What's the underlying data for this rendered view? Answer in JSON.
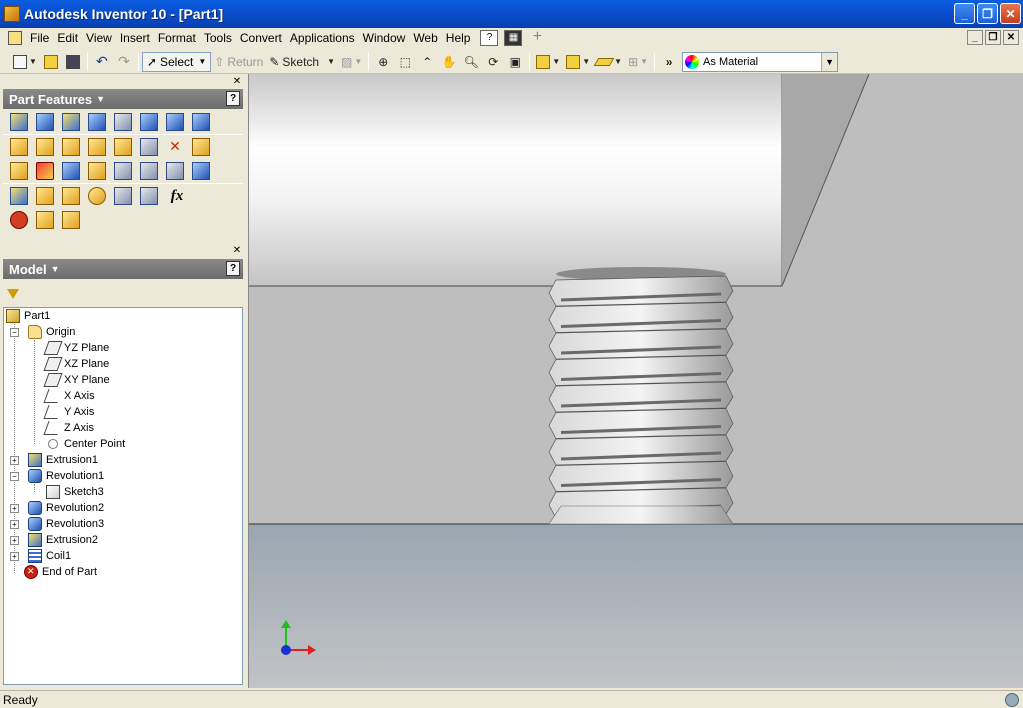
{
  "window": {
    "title": "Autodesk Inventor 10 - [Part1]",
    "icon": "inventor-app-icon",
    "buttons": [
      "minimize",
      "restore",
      "close"
    ]
  },
  "menu": {
    "items": [
      "File",
      "Edit",
      "View",
      "Insert",
      "Format",
      "Tools",
      "Convert",
      "Applications",
      "Window",
      "Web",
      "Help"
    ]
  },
  "toolbar": {
    "select_label": "Select",
    "return_label": "Return",
    "sketch_label": "Sketch",
    "material_value": "As Material"
  },
  "part_features": {
    "title": "Part Features",
    "help": "?"
  },
  "model_panel": {
    "title": "Model",
    "help": "?"
  },
  "tree": {
    "root": "Part1",
    "origin": "Origin",
    "yz_plane": "YZ Plane",
    "xz_plane": "XZ Plane",
    "xy_plane": "XY Plane",
    "x_axis": "X Axis",
    "y_axis": "Y Axis",
    "z_axis": "Z Axis",
    "center_point": "Center Point",
    "extrusion1": "Extrusion1",
    "revolution1": "Revolution1",
    "sketch3": "Sketch3",
    "revolution2": "Revolution2",
    "revolution3": "Revolution3",
    "extrusion2": "Extrusion2",
    "coil1": "Coil1",
    "end_of_part": "End of Part"
  },
  "status": {
    "text": "Ready"
  },
  "colors": {
    "titlebar": "#0a50d0",
    "panel_header": "#7a7a7a",
    "axis_x": "#e02020",
    "axis_y": "#20c020",
    "axis_origin": "#1a30d0"
  }
}
